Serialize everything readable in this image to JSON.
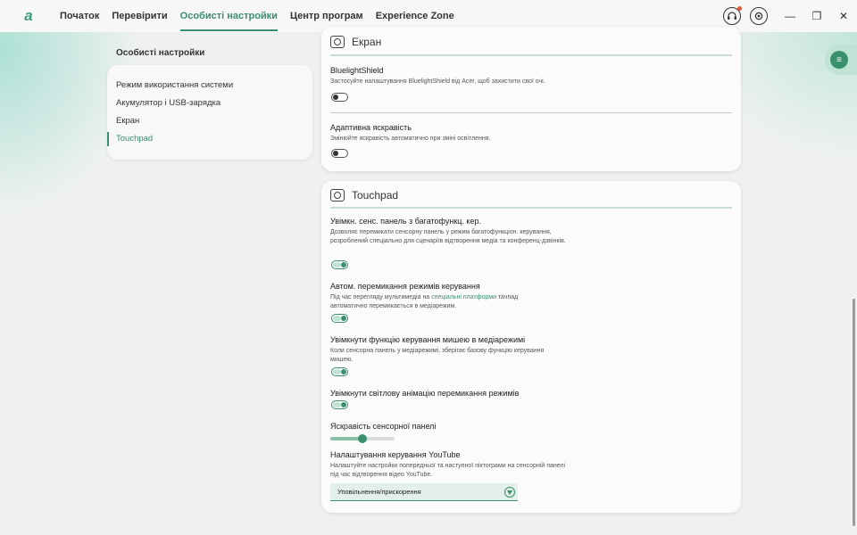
{
  "nav": {
    "logo": "a",
    "tabs": [
      "Початок",
      "Перевірити",
      "Особисті настройки",
      "Центр програм",
      "Experience Zone"
    ],
    "active_tab": "Особисті настройки"
  },
  "window": {
    "minimize": "—",
    "maximize": "❐",
    "close": "✕"
  },
  "sidebar": {
    "title": "Особисті настройки",
    "items": [
      {
        "label": "Режим використання системи"
      },
      {
        "label": "Акумулятор і USB-зарядка"
      },
      {
        "label": "Екран"
      },
      {
        "label": "Touchpad"
      }
    ],
    "active": "Touchpad"
  },
  "screen_card": {
    "title": "Екран",
    "bluelight": {
      "title": "BluelightShield",
      "desc": "Застосуйте налаштування BluelightShield від Acer, щоб захистити свої очі.",
      "enabled": false
    },
    "adaptive": {
      "title": "Адаптивна яскравість",
      "desc": "Змінюйте яскравість автоматично при зміні освітлення.",
      "enabled": false
    }
  },
  "touchpad_card": {
    "title": "Touchpad",
    "multifunction": {
      "title": "Увімкн. сенс. панель з багатофункц. кер.",
      "desc": "Дозволяє перемикати сенсорну панель у режим багатофункціон. керування, розроблений спеціально для сценаріїв відтворення медіа та конференц-дзвінків.",
      "enabled": true
    },
    "auto_switch": {
      "title": "Автом. перемикання режимів керування",
      "desc_before": "Під час перегляду мультимедіа на ",
      "desc_link": "спеціальні платформи",
      "desc_after": " тачпад автоматично перемикається в медіарежим.",
      "enabled": true
    },
    "mouse_in_media": {
      "title": "Увімкнути функцію керування мишею в медіарежимі",
      "desc": "Коли сенсорна панель у медіарежимі, зберігає базову функцію керування мишею.",
      "enabled": true
    },
    "light_anim": {
      "title": "Увімкнути світлову анімацію перемикання режимів",
      "enabled": true
    },
    "brightness": {
      "title": "Яскравість сенсорної панелі",
      "level": 0.5
    },
    "youtube": {
      "title": "Налаштування керування YouTube",
      "desc": "Налаштуйте настройки попередньої та наступної піктограми на сенсорній панелі під час відтворення відео YouTube.",
      "selected": "Уповільнення/прискорення"
    }
  },
  "colors": {
    "accent": "#3a8f6c",
    "toggle_track_on": "#bfe2d3"
  }
}
